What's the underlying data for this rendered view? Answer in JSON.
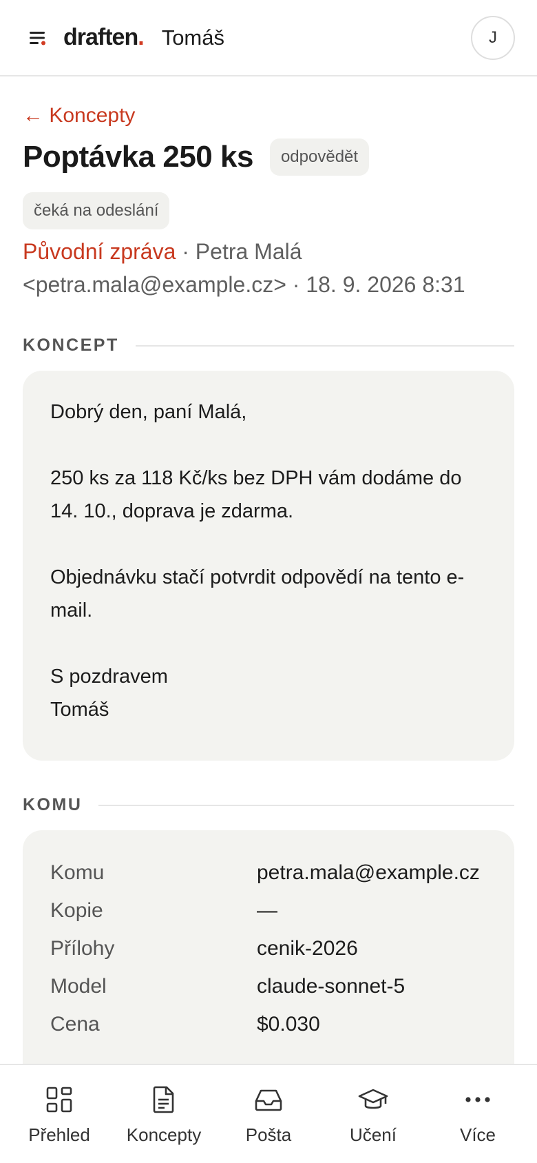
{
  "header": {
    "logo": "draften",
    "logo_dot": ".",
    "user_name": "Tomáš",
    "avatar_initial": "J"
  },
  "draft": {
    "back_label": "← Koncepty",
    "title": "Poptávka 250 ks",
    "reply_chip": "odpovědět",
    "status_chip": "čeká na odeslání",
    "original_link": "Původní zpráva",
    "sender": " · Petra Malá <petra.mala@example.cz> · 18. 9. 2026 8:31"
  },
  "sections": {
    "draft_label": "KONCEPT",
    "recipients_label": "KOMU"
  },
  "body": {
    "greeting": "Dobrý den, paní Malá,",
    "para1": "250 ks za 118 Kč/ks bez DPH vám dodáme do 14. 10., doprava je zdarma.",
    "para2": "Objednávku stačí potvrdit odpovědí na tento e-mail.",
    "closing": "S pozdravem",
    "signature": "Tomáš"
  },
  "info": [
    {
      "key": "Komu",
      "value": "petra.mala@example.cz"
    },
    {
      "key": "Kopie",
      "value": "—"
    },
    {
      "key": "Přílohy",
      "value": "cenik-2026"
    },
    {
      "key": "Model",
      "value": "claude-sonnet-5"
    },
    {
      "key": "Cena",
      "value": "$0.030"
    }
  ],
  "nav": {
    "overview": "Přehled",
    "drafts": "Koncepty",
    "mail": "Pošta",
    "learning": "Učení",
    "more": "Více"
  },
  "colors": {
    "accent": "#c8391f",
    "card_bg": "#f3f3f0"
  }
}
